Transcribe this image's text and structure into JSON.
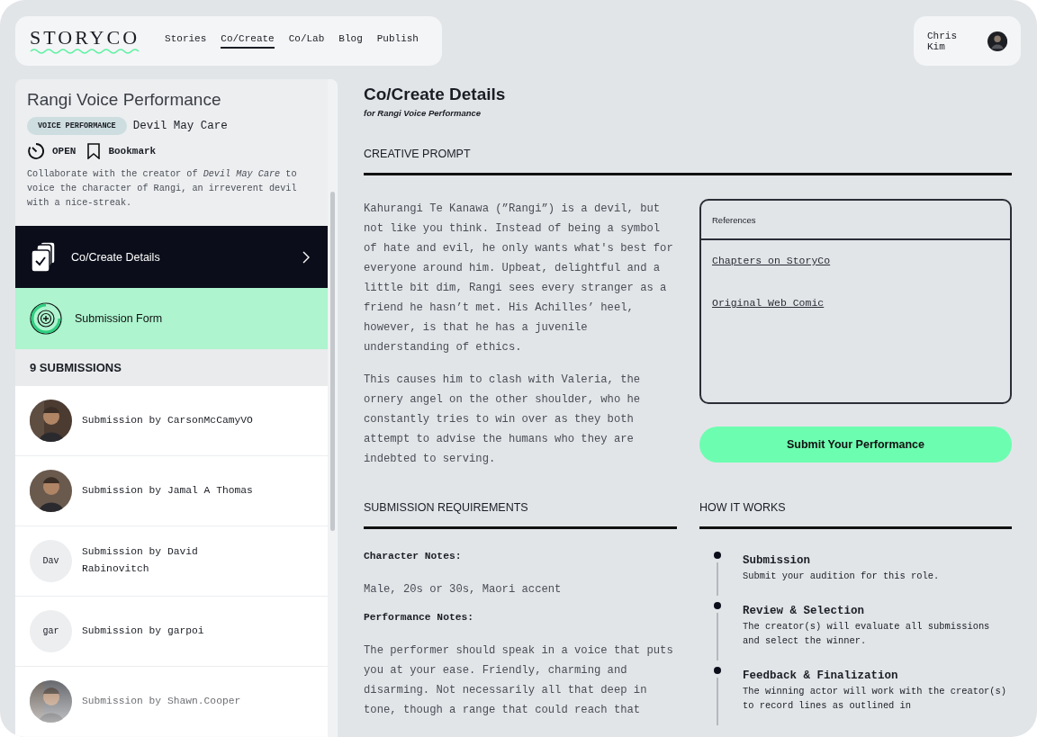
{
  "logo": "STORYCO",
  "nav": [
    {
      "label": "Stories",
      "selected": false
    },
    {
      "label": "Co/Create",
      "selected": true
    },
    {
      "label": "Co/Lab",
      "selected": false
    },
    {
      "label": "Blog",
      "selected": false
    },
    {
      "label": "Publish",
      "selected": false
    }
  ],
  "user": {
    "name": "Chris Kim"
  },
  "sidebar": {
    "title": "Rangi Voice Performance",
    "tag": "VOICE PERFORMANCE",
    "story": "Devil May Care",
    "status": "OPEN",
    "bookmark": "Bookmark",
    "description": "Collaborate with the creator of *Devil May Care* to voice the character of Rangi, an irreverent devil with a nice-streak.",
    "menu": [
      {
        "label": "Co/Create Details",
        "kind": "details",
        "selected": true
      },
      {
        "label": "Submission Form",
        "kind": "form",
        "selected": false
      }
    ],
    "submissions_header": "9 SUBMISSIONS",
    "submissions": [
      {
        "label": "Submission by CarsonMcCamyVO"
      },
      {
        "label": "Submission by Jamal A Thomas"
      },
      {
        "label": "Submission by David Rabinovitch",
        "avatar": {
          "kind": "initials",
          "text": "Dav"
        }
      },
      {
        "label": "Submission by garpoi",
        "avatar": {
          "kind": "initials",
          "text": "gar"
        }
      },
      {
        "label": "Submission by Shawn.Cooper"
      }
    ]
  },
  "main": {
    "title": "Co/Create Details",
    "subtitle": "for Rangi Voice Performance",
    "prompt": {
      "heading": "CREATIVE PROMPT",
      "paragraphs": [
        "Kahurangi Te Kanawa (”Rangi”) is a devil, but not like you think. Instead of being a symbol of hate and evil, he only wants what's best for everyone around him. Upbeat, delightful and a little bit dim, Rangi sees every stranger as a friend he hasn’t met. His Achilles’ heel, however, is that he has a juvenile understanding of ethics.",
        "This causes him to clash with Valeria, the ornery angel on the other shoulder, who he constantly tries to win over as they both attempt to advise the humans who they are indebted to serving."
      ]
    },
    "references": {
      "title": "References",
      "links": [
        "Chapters on StoryCo",
        "Original Web Comic"
      ]
    },
    "submit_button": "Submit Your Performance",
    "requirements": {
      "heading": "SUBMISSION REQUIREMENTS",
      "items": [
        {
          "kind": "label",
          "text": "Character Notes:"
        },
        {
          "kind": "text",
          "text": "Male, 20s or 30s, Maori accent"
        },
        {
          "kind": "label",
          "text": "Performance Notes:"
        },
        {
          "kind": "text",
          "text": "The performer should speak in a voice that puts you at your ease. Friendly, charming and disarming. Not necessarily all that deep in tone, though a range that could reach that"
        }
      ]
    },
    "how_it_works": {
      "heading": "HOW IT WORKS",
      "steps": [
        {
          "title": "Submission",
          "description": "Submit your audition for this role."
        },
        {
          "title": "Review & Selection",
          "description": "The creator(s) will evaluate all submissions and select the winner."
        },
        {
          "title": "Feedback & Finalization",
          "description": "The winning actor will work with the creator(s) to record lines as outlined in"
        }
      ]
    }
  }
}
